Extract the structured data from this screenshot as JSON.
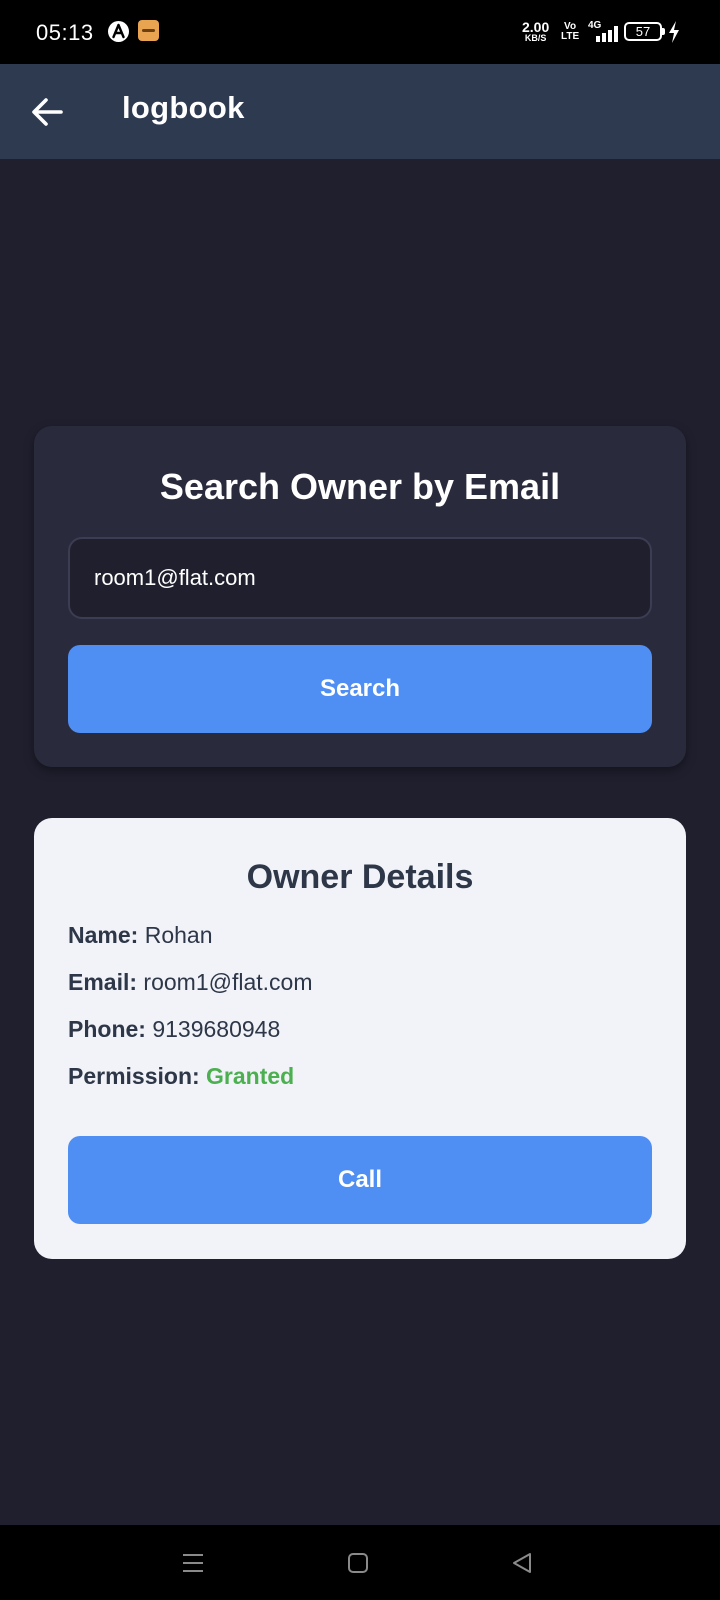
{
  "status_bar": {
    "time": "05:13",
    "net_speed": "2.00",
    "net_speed_unit": "KB/S",
    "volte_top": "Vo",
    "volte_bottom": "LTE",
    "network": "4G",
    "battery": "57"
  },
  "app_bar": {
    "title": "logbook",
    "back_icon": "arrow-left-icon"
  },
  "search": {
    "title": "Search Owner by Email",
    "input_value": "room1@flat.com",
    "button_label": "Search"
  },
  "owner": {
    "title": "Owner Details",
    "name_label": "Name:",
    "name": "Rohan",
    "email_label": "Email:",
    "email": "room1@flat.com",
    "phone_label": "Phone:",
    "phone": "9139680948",
    "permission_label": "Permission:",
    "permission": "Granted",
    "call_label": "Call"
  },
  "colors": {
    "background": "#1f1f2e",
    "app_bar": "#2e3a4f",
    "card_dark": "#2a2a3d",
    "card_light": "#f2f3f8",
    "accent": "#4f8ef3",
    "granted": "#4caf50"
  }
}
